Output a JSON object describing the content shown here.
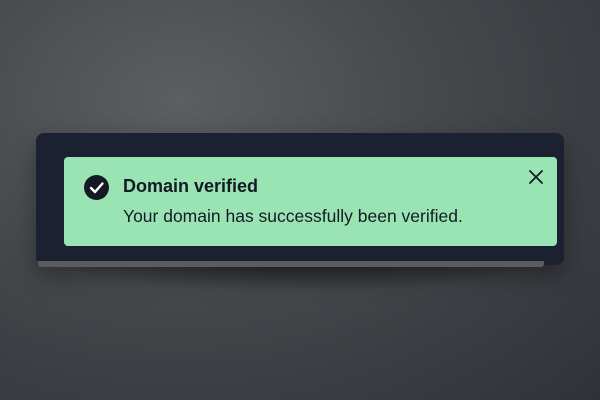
{
  "toast": {
    "title": "Domain verified",
    "message": "Your domain has successfully been verified.",
    "status": "success",
    "icon": "check-circle-icon",
    "close_icon": "close-icon",
    "colors": {
      "background": "#9ae4b3",
      "text": "#141a24",
      "panel": "#1b2130"
    }
  }
}
